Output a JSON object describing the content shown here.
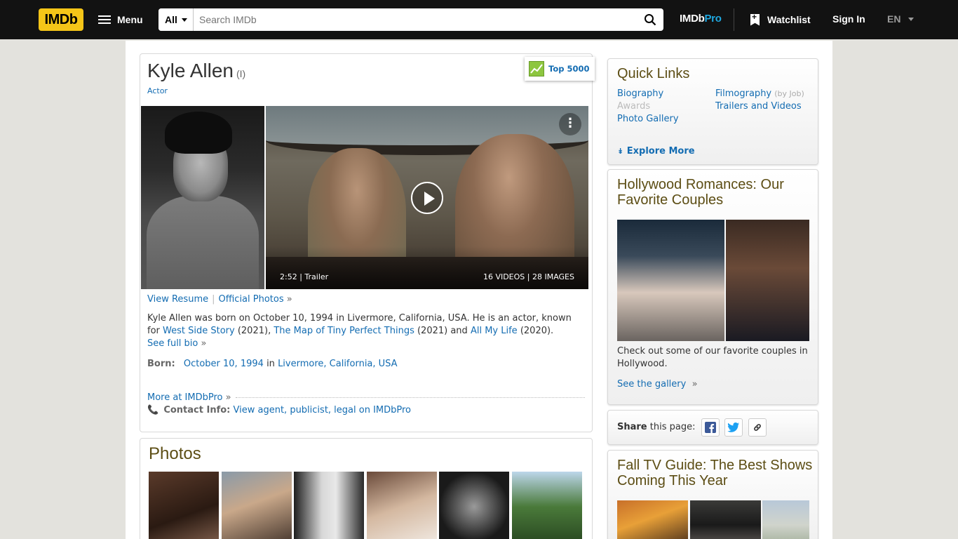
{
  "nav": {
    "logo": "IMDb",
    "menu_label": "Menu",
    "search_category": "All",
    "search_placeholder": "Search IMDb",
    "imdbpro_main": "IMDb",
    "imdbpro_pro": "Pro",
    "watchlist_label": "Watchlist",
    "signin_label": "Sign In",
    "language": "EN"
  },
  "person": {
    "name": "Kyle Allen",
    "suffix": "(I)",
    "role": "Actor",
    "meter_label": "Top 5000"
  },
  "video": {
    "duration": "2:52",
    "type": "Trailer",
    "counts": "16 VIDEOS | 28 IMAGES"
  },
  "links": {
    "view_resume": "View Resume",
    "official_photos": "Official Photos"
  },
  "bio": {
    "text_prefix": "Kyle Allen was born on October 10, 1994 in Livermore, California, USA. He is an actor, known for",
    "film1": "West Side Story",
    "film1_year": "(2021),",
    "film2": "The Map of Tiny Perfect Things",
    "film2_year": "(2021) and",
    "film3": "All My Life",
    "film3_year": "(2020).",
    "see_full_bio": "See full bio"
  },
  "born": {
    "label": "Born:",
    "date": "October 10, 1994",
    "in_word": "in",
    "place": "Livermore, California, USA"
  },
  "pro": {
    "more_label": "More at IMDbPro",
    "contact_label": "Contact Info:",
    "contact_link": "View agent, publicist, legal on IMDbPro"
  },
  "photos": {
    "title": "Photos"
  },
  "quick_links": {
    "title": "Quick Links",
    "biography": "Biography",
    "awards": "Awards",
    "photo_gallery": "Photo Gallery",
    "filmography": "Filmography",
    "filmography_sub": "(by Job)",
    "trailers": "Trailers and Videos",
    "explore_more": "Explore More"
  },
  "romances": {
    "title": "Hollywood Romances: Our Favorite Couples",
    "text": "Check out some of our favorite couples in Hollywood.",
    "link": "See the gallery"
  },
  "share": {
    "label_bold": "Share",
    "label_rest": "this page:"
  },
  "fall_tv": {
    "title": "Fall TV Guide: The Best Shows Coming This Year"
  },
  "colors": {
    "imdb_yellow": "#f5c518",
    "link_blue": "#136cb2",
    "heading_brown": "#5c4d14",
    "topbar": "#121212"
  }
}
